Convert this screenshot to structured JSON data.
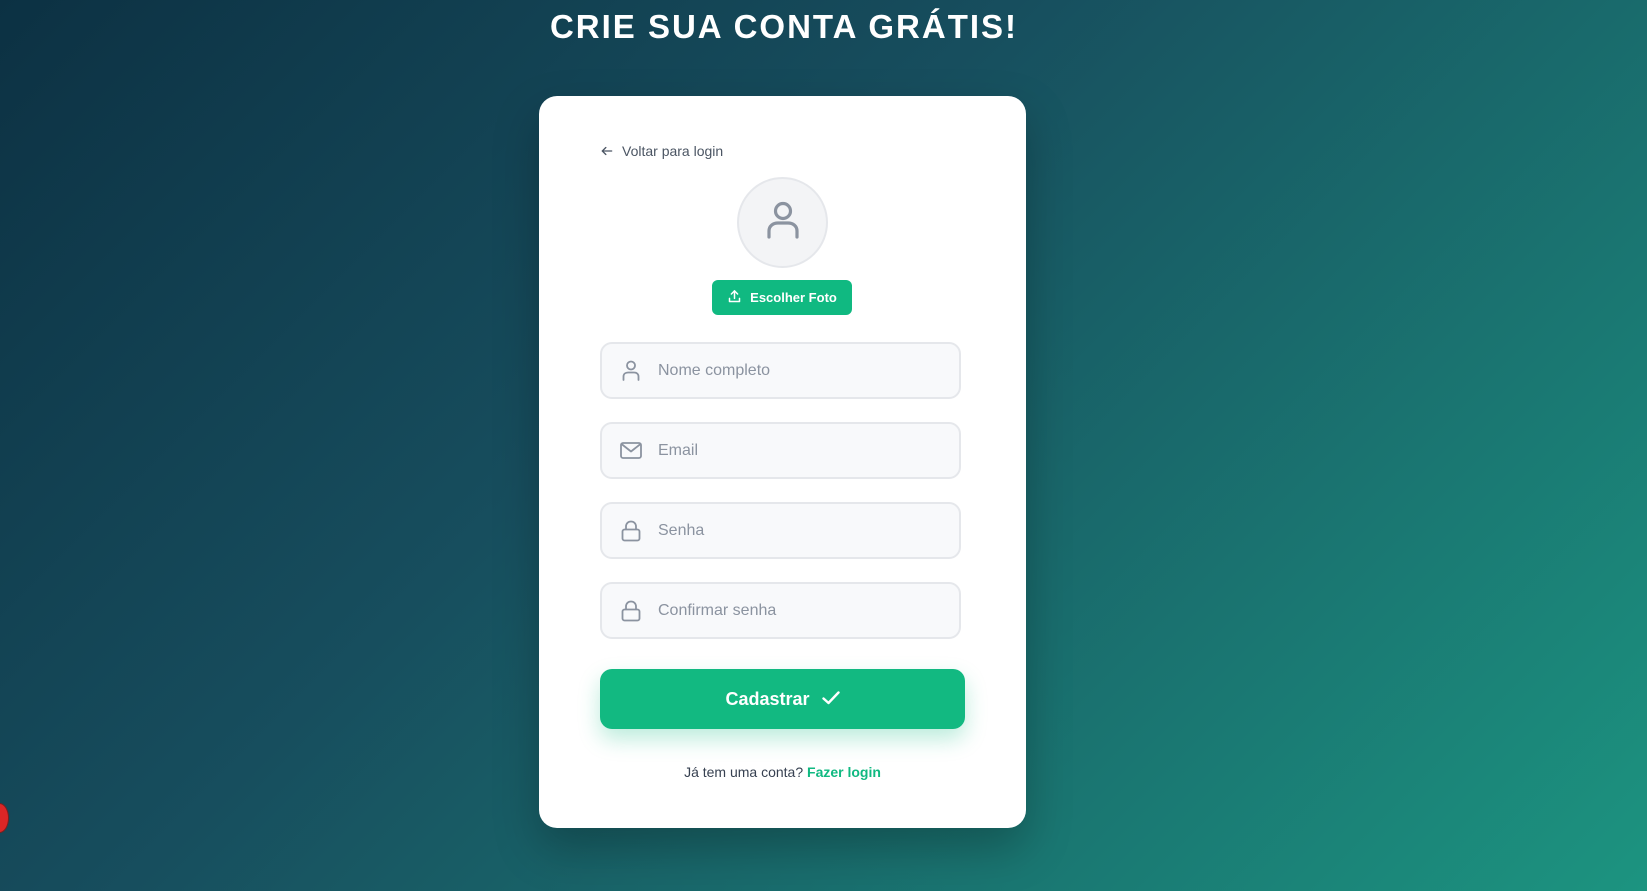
{
  "page": {
    "title": "CRIE SUA CONTA GRÁTIS!"
  },
  "card": {
    "back_link": {
      "icon": "arrow-left-icon",
      "label": "Voltar para login"
    },
    "avatar": {
      "icon": "user-icon"
    },
    "photo_button": {
      "icon": "upload-icon",
      "label": "Escolher Foto"
    },
    "fields": {
      "name": {
        "icon": "user-icon",
        "placeholder": "Nome completo",
        "value": ""
      },
      "email": {
        "icon": "mail-icon",
        "placeholder": "Email",
        "value": ""
      },
      "password": {
        "icon": "lock-icon",
        "placeholder": "Senha",
        "value": ""
      },
      "confirm_password": {
        "icon": "lock-icon",
        "placeholder": "Confirmar senha",
        "value": ""
      }
    },
    "submit_button": {
      "label": "Cadastrar",
      "icon": "check-icon"
    },
    "footer": {
      "text": "Já tem uma conta?",
      "link_label": "Fazer login"
    }
  },
  "colors": {
    "accent": "#10b981",
    "background_start": "#0c3143",
    "background_end": "#1c9480",
    "card": "#ffffff"
  }
}
